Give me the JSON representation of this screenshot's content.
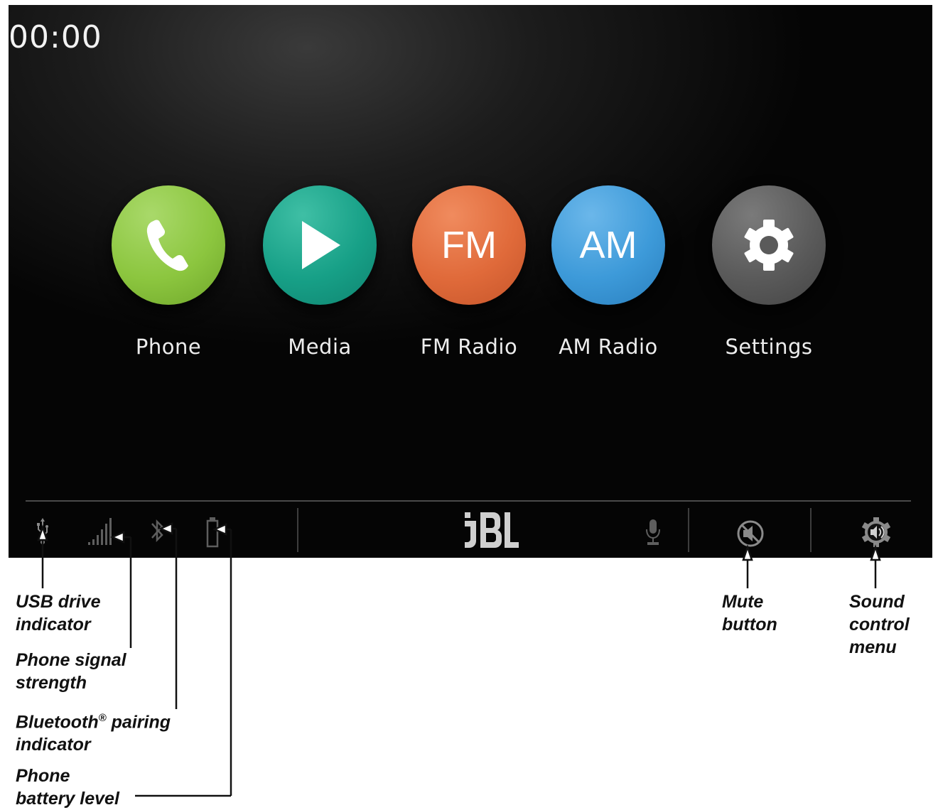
{
  "clock": "00:00",
  "apps": [
    {
      "label": "Phone",
      "icon": "phone-icon",
      "color": "#8cc63f"
    },
    {
      "label": "Media",
      "icon": "play-icon",
      "color": "#17a087"
    },
    {
      "label": "FM Radio",
      "icon": "FM",
      "color": "#e06a3a"
    },
    {
      "label": "AM Radio",
      "icon": "AM",
      "color": "#3d9ad9"
    },
    {
      "label": "Settings",
      "icon": "gear-icon",
      "color": "#5a5a5a"
    }
  ],
  "status_bar": {
    "icons": [
      "usb-icon",
      "signal-icon",
      "bluetooth-icon",
      "battery-icon",
      "microphone-icon"
    ],
    "brand": "JBL",
    "buttons": [
      "mute-icon",
      "sound-settings-icon"
    ]
  },
  "callouts": {
    "usb": [
      "USB drive",
      "indicator"
    ],
    "signal": [
      "Phone signal",
      "strength"
    ],
    "bluetooth": [
      "Bluetooth",
      "pairing",
      "indicator"
    ],
    "battery": [
      "Phone",
      "battery level"
    ],
    "mute": [
      "Mute",
      "button"
    ],
    "sound": [
      "Sound",
      "control",
      "menu"
    ]
  }
}
